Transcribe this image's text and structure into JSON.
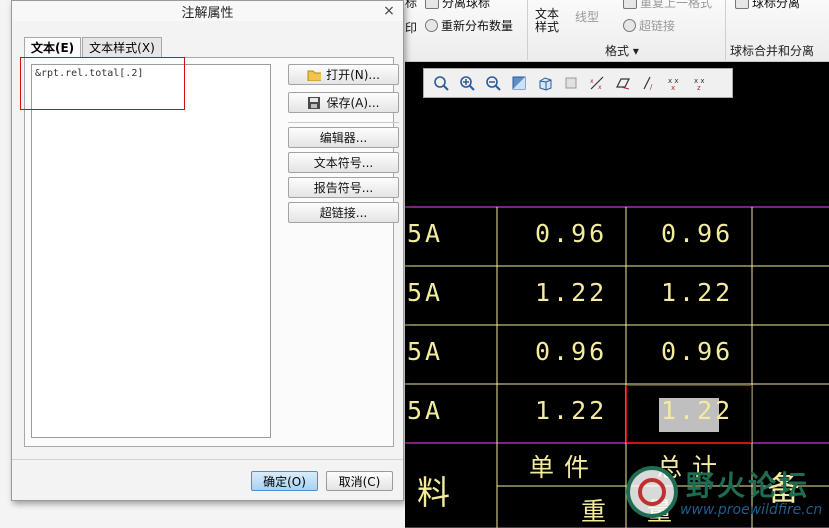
{
  "dialog": {
    "title": "注解属性",
    "close_symbol": "×",
    "tabs": [
      {
        "label": "文本(E)",
        "active": true
      },
      {
        "label": "文本样式(X)",
        "active": false
      }
    ],
    "text_value": "&rpt.rel.total[.2]",
    "side_buttons": {
      "open": "打开(N)...",
      "save": "保存(A)...",
      "editor": "编辑器...",
      "text_symbol": "文本符号...",
      "report_symbol": "报告符号...",
      "hyperlink": "超链接..."
    },
    "ok_label": "确定(O)",
    "cancel_label": "取消(C)"
  },
  "ribbon": {
    "separate_balloon": "分离球标",
    "redistribute_qty": "重新分布数量",
    "text_style_line1": "文本",
    "text_style_line2": "样式",
    "line_style": "线型",
    "repeat_last": "重复上一格式",
    "hyperlink": "超链接",
    "group_format": "格式",
    "group_balloon": "球标合并和分离",
    "balloon_merge_top": "球标分离",
    "left_clip": "标",
    "left_clip2": "印"
  },
  "table": {
    "rows": [
      {
        "left": "5A",
        "unit": "0.96",
        "total": "0.96"
      },
      {
        "left": "5A",
        "unit": "1.22",
        "total": "1.22"
      },
      {
        "left": "5A",
        "unit": "0.96",
        "total": "0.96"
      },
      {
        "left": "5A",
        "unit": "1.22",
        "total": "1.22"
      }
    ],
    "header_material": "料",
    "header_unit": "单件",
    "header_total": "总计",
    "header_note": "备",
    "header_weight_a": "重",
    "header_weight_b": "量"
  },
  "watermark": {
    "text": "野火论坛",
    "url": "www.proewildfire.cn"
  },
  "colors": {
    "cad_text": "#f2ec9c",
    "table_line": "#c43bd3",
    "highlight": "#d01010",
    "canvas_bg": "#000000"
  }
}
